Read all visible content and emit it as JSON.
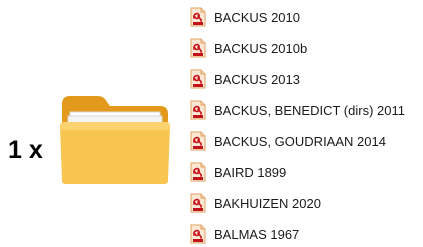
{
  "selection": {
    "count_label": "1 x",
    "folder_icon": "folder-icon"
  },
  "files": [
    {
      "name": "BACKUS 2010",
      "icon": "pdf-file-icon"
    },
    {
      "name": "BACKUS 2010b",
      "icon": "pdf-file-icon"
    },
    {
      "name": "BACKUS 2013",
      "icon": "pdf-file-icon"
    },
    {
      "name": "BACKUS, BENEDICT (dirs) 2011",
      "icon": "pdf-file-icon"
    },
    {
      "name": "BACKUS, GOUDRIAAN 2014",
      "icon": "pdf-file-icon"
    },
    {
      "name": "BAIRD 1899",
      "icon": "pdf-file-icon"
    },
    {
      "name": "BAKHUIZEN 2020",
      "icon": "pdf-file-icon"
    },
    {
      "name": "BALMAS 1967",
      "icon": "pdf-file-icon"
    }
  ],
  "colors": {
    "folder_back": "#e39a1c",
    "folder_front": "#f8c650",
    "folder_paper": "#ffffff",
    "pdf_red": "#c4121a",
    "pdf_page": "#fbe8d4",
    "pdf_border": "#e0a060"
  }
}
